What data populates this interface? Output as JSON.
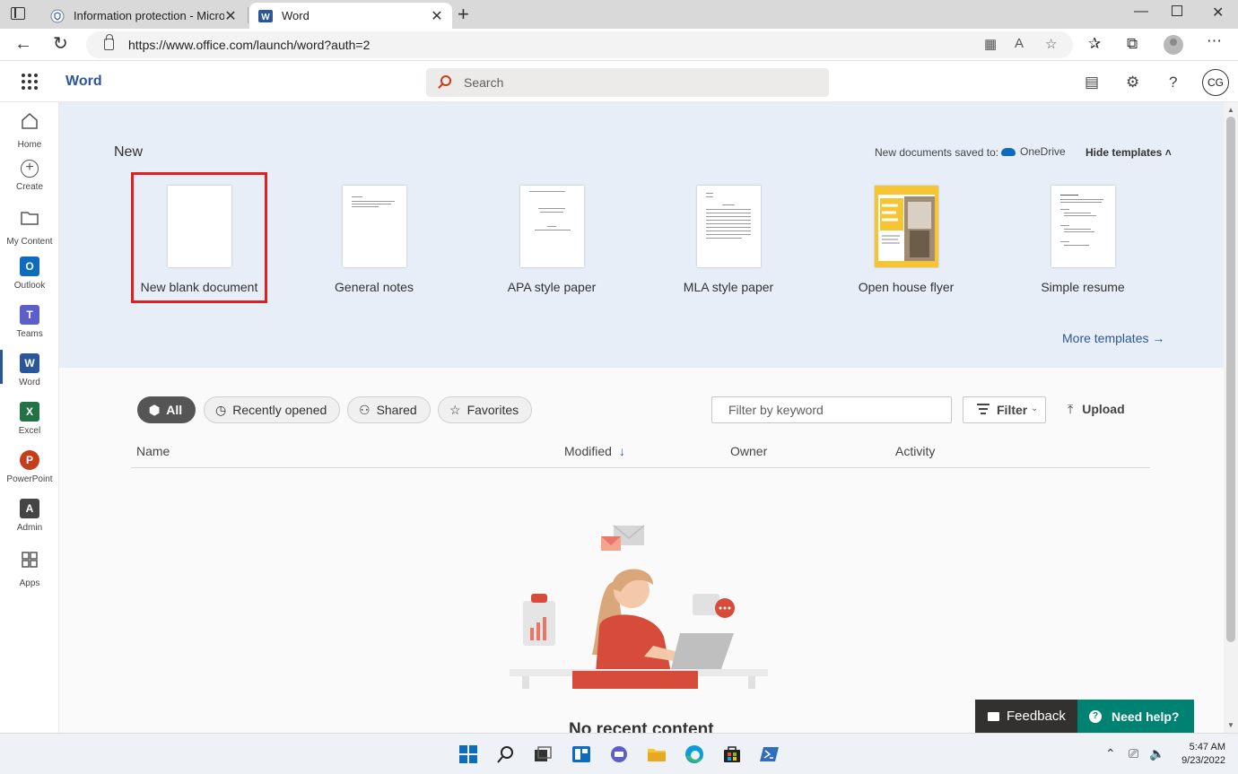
{
  "browser": {
    "tabs": [
      {
        "title": "Information protection - Microsc",
        "active": false
      },
      {
        "title": "Word",
        "active": true
      }
    ],
    "url": "https://www.office.com/launch/word?auth=2"
  },
  "header": {
    "app_name": "Word",
    "search_placeholder": "Search",
    "avatar_initials": "CG"
  },
  "rail": {
    "items": [
      {
        "label": "Home"
      },
      {
        "label": "Create"
      },
      {
        "label": "My Content"
      },
      {
        "label": "Outlook",
        "badge": "O",
        "color": "#0f6cbd"
      },
      {
        "label": "Teams",
        "badge": "T",
        "color": "#5b5fc7"
      },
      {
        "label": "Word",
        "badge": "W",
        "color": "#2b579a"
      },
      {
        "label": "Excel",
        "badge": "X",
        "color": "#217346"
      },
      {
        "label": "PowerPoint",
        "badge": "P",
        "color": "#c43e1c"
      },
      {
        "label": "Admin",
        "badge": "A",
        "color": "#444444"
      },
      {
        "label": "Apps"
      }
    ]
  },
  "templates": {
    "heading": "New",
    "saved_to_label": "New documents saved to:",
    "saved_to_location": "OneDrive",
    "hide_label": "Hide templates",
    "items": [
      {
        "label": "New blank document"
      },
      {
        "label": "General notes"
      },
      {
        "label": "APA style paper"
      },
      {
        "label": "MLA style paper"
      },
      {
        "label": "Open house flyer"
      },
      {
        "label": "Simple resume"
      }
    ],
    "more_label": "More templates"
  },
  "files": {
    "filters": [
      {
        "label": "All",
        "icon": "cube-icon"
      },
      {
        "label": "Recently opened",
        "icon": "clock-icon"
      },
      {
        "label": "Shared",
        "icon": "people-icon"
      },
      {
        "label": "Favorites",
        "icon": "star-icon"
      }
    ],
    "keyword_placeholder": "Filter by keyword",
    "filter_label": "Filter",
    "upload_label": "Upload",
    "columns": [
      "Name",
      "Modified",
      "Owner",
      "Activity"
    ],
    "empty_text": "No recent content"
  },
  "footer": {
    "feedback_label": "Feedback",
    "help_label": "Need help?"
  },
  "taskbar": {
    "time": "5:47 AM",
    "date": "9/23/2022"
  }
}
